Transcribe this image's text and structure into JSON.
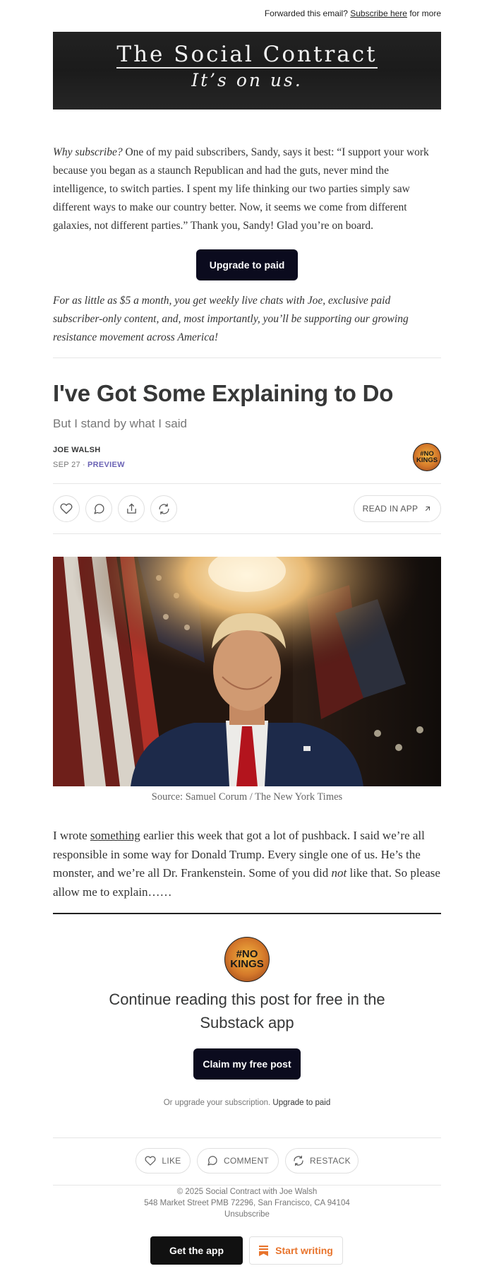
{
  "header": {
    "forward_text": "Forwarded this email?",
    "subscribe_link": "Subscribe here",
    "for_more": "for more"
  },
  "banner": {
    "title": "The Social Contract",
    "subtitle": "It’s on us."
  },
  "pitch": {
    "lead": "Why subscribe?",
    "text": " One of my paid subscribers, Sandy, says it best: “I support your work because you began as a staunch Republican and had the guts, never mind the intelligence, to switch parties. I spent my life thinking our two parties simply saw different ways to make our country better. Now, it seems we come from different galaxies, not different parties.” Thank you, Sandy! Glad you’re on board.",
    "upgrade_button": "Upgrade to paid",
    "offer": "For as little as $5 a month, you get weekly live chats with Joe, exclusive paid subscriber-only content, and, most importantly, you’ll be supporting our growing resistance movement across America!"
  },
  "post": {
    "title": "I've Got Some Explaining to Do",
    "subtitle": "But I stand by what I said",
    "author": "JOE WALSH",
    "date": "SEP 27",
    "separator": "∙",
    "preview": "PREVIEW",
    "read_in_app": "READ IN APP",
    "badge_line1": "#NO",
    "badge_line2": "KINGS",
    "caption": "Source: Samuel Corum / The New York Times",
    "body_1": "I wrote ",
    "body_link": "something",
    "body_2": " earlier this week that got a lot of pushback. I said we’re all responsible in some way for Donald Trump. Every single one of us. He’s the monster, and we’re all Dr. Frankenstein. Some of you did ",
    "body_em": "not",
    "body_3": " like that. So please allow me to explain……"
  },
  "paywall": {
    "heading": "Continue reading this post for free in the Substack app",
    "claim_button": "Claim my free post",
    "or_upgrade": "Or upgrade your subscription.",
    "upgrade_link": "Upgrade to paid"
  },
  "actions": {
    "like": "LIKE",
    "comment": "COMMENT",
    "restack": "RESTACK"
  },
  "footer": {
    "copyright": "© 2025 Social Contract with Joe Walsh",
    "address": "548 Market Street PMB 72296, San Francisco, CA 94104",
    "unsubscribe": "Unsubscribe",
    "get_app": "Get the app",
    "start_writing": "Start writing"
  },
  "colors": {
    "accent_dark": "#0b0b1e",
    "preview_purple": "#6b63b5",
    "substack_orange": "#e8742c"
  }
}
